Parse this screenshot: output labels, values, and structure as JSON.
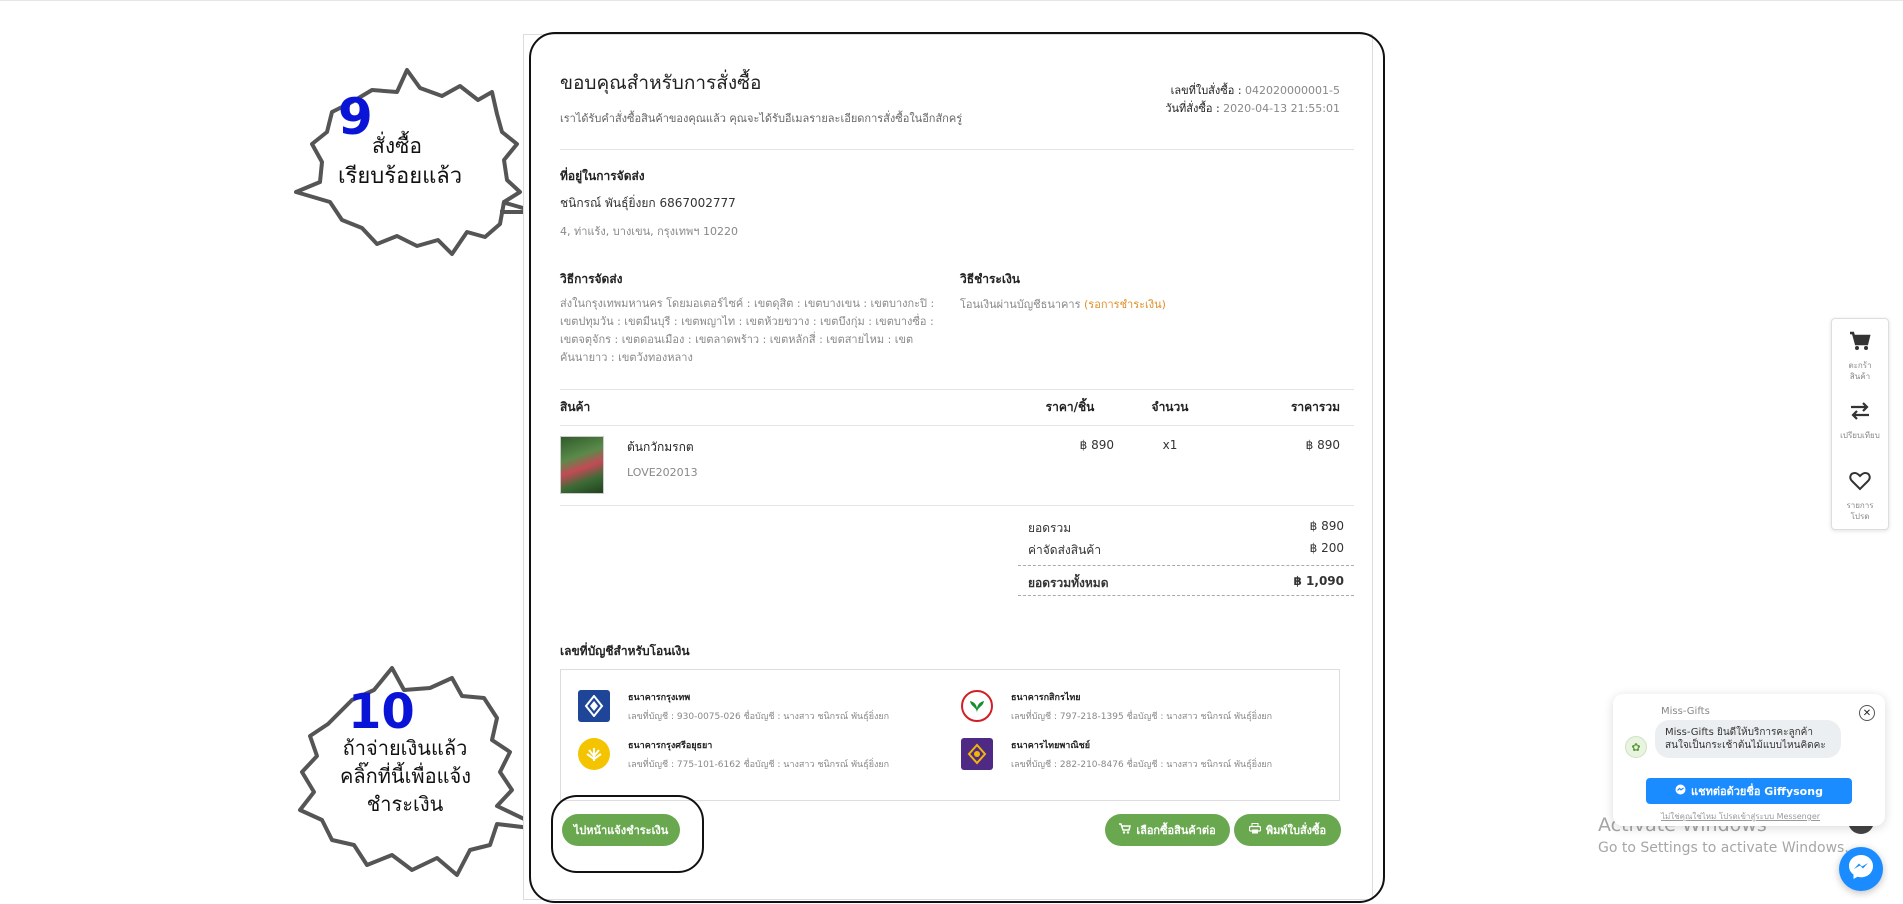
{
  "order": {
    "thanks_title": "ขอบคุณสำหรับการสั่งซื้อ",
    "thanks_subtitle": "เราได้รับคำสั่งซื้อสินค้าของคุณแล้ว คุณจะได้รับอีเมลรายละเอียดการสั่งซื้อในอีกสักครู่",
    "order_no_label": "เลขที่ใบสั่งซื้อ :",
    "order_no": "042020000001-5",
    "order_date_label": "วันที่สั่งซื้อ :",
    "order_date": "2020-04-13 21:55:01"
  },
  "address": {
    "title": "ที่อยู่ในการจัดส่ง",
    "name_phone": "ชนิกรณ์ พันธุ์ยิ่งยก   6867002777",
    "line": "4, ท่าแร้ง, บางเขน, กรุงเทพฯ 10220"
  },
  "shipping": {
    "title": "วิธีการจัดส่ง",
    "desc": "ส่งในกรุงเทพมหานคร โดยมอเตอร์ไซค์ : เขตดุสิต : เขตบางเขน : เขตบางกะปิ : เขตปทุมวัน : เขตมีนบุรี : เขตพญาไท : เขตห้วยขวาง : เขตบึงกุ่ม : เขตบางซื่อ : เขตจตุจักร : เขตดอนเมือง : เขตลาดพร้าว : เขตหลักสี่ : เขตสายไหม : เขตคันนายาว : เขตวังทองหลาง"
  },
  "payment": {
    "title": "วิธีชำระเงิน",
    "method": "โอนเงินผ่านบัญชีธนาคาร",
    "status": "(รอการชำระเงิน)"
  },
  "table": {
    "col_product": "สินค้า",
    "col_price": "ราคา/ชิ้น",
    "col_qty": "จำนวน",
    "col_total": "ราคารวม",
    "items": [
      {
        "name": "ต้นกวักมรกต",
        "sku": "LOVE202013",
        "price": "฿ 890",
        "qty": "x1",
        "total": "฿ 890"
      }
    ]
  },
  "totals": {
    "subtotal_label": "ยอดรวม",
    "subtotal": "฿ 890",
    "shipping_label": "ค่าจัดส่งสินค้า",
    "shipping": "฿ 200",
    "grand_label": "ยอดรวมทั้งหมด",
    "grand": "฿ 1,090"
  },
  "banks": {
    "title": "เลขที่บัญชีสำหรับโอนเงิน",
    "list": [
      {
        "name": "ธนาคารกรุงเทพ",
        "acct": "เลขที่บัญชี : 930-0075-026 ชื่อบัญชี : นางสาว ชนิกรณ์ พันธุ์ยิ่งยก",
        "color": "#1e4598",
        "icon": "bbl-logo-icon"
      },
      {
        "name": "ธนาคารกสิกรไทย",
        "acct": "เลขที่บัญชี : 797-218-1395 ชื่อบัญชี : นางสาว ชนิกรณ์ พันธุ์ยิ่งยก",
        "color": "#138f2d",
        "icon": "kbank-logo-icon"
      },
      {
        "name": "ธนาคารกรุงศรีอยุธยา",
        "acct": "เลขที่บัญชี : 775-101-6162 ชื่อบัญชี : นางสาว ชนิกรณ์ พันธุ์ยิ่งยก",
        "color": "#f5c400",
        "icon": "krungsri-logo-icon"
      },
      {
        "name": "ธนาคารไทยพาณิชย์",
        "acct": "เลขที่บัญชี : 282-210-8476 ชื่อบัญชี : นางสาว ชนิกรณ์ พันธุ์ยิ่งยก",
        "color": "#4e2a84",
        "icon": "scb-logo-icon"
      }
    ]
  },
  "buttons": {
    "pay_notify": "ไปหน้าแจ้งชำระเงิน",
    "continue": "เลือกซื้อสินค้าต่อ",
    "print": "พิมพ์ใบสั่งซื้อ"
  },
  "annotations": {
    "step9_num": "9",
    "step9_line1": "สั่งซื้อ",
    "step9_line2": "เรียบร้อยแล้ว",
    "step10_num": "10",
    "step10_line1": "ถ้าจ่ายเงินแล้ว",
    "step10_line2": "คลิ๊กที่นี้เพื่อแจ้ง",
    "step10_line3": "ชำระเงิน"
  },
  "sidebar": {
    "items": [
      {
        "label": "ตะกร้าสินค้า",
        "icon": "cart-icon"
      },
      {
        "label": "เปรียบเทียบ",
        "icon": "compare-icon"
      },
      {
        "label": "รายการโปรด",
        "icon": "heart-icon"
      }
    ]
  },
  "chat": {
    "page_name": "Miss-Gifts",
    "message": "Miss-Gifts ยินดีให้บริการคะลูกค้าสนใจเป็นกระเช้าต้นไม้แบบไหนคิดคะ",
    "button": "แชทต่อด้วยชื่อ Giffysong",
    "footer": "ไม่ใช่คุณใช่ไหม โปรดเข้าสู่ระบบ Messenger"
  },
  "watermark": {
    "line1": "Activate Windows",
    "line2": "Go to Settings to activate Windows."
  },
  "colors": {
    "button_green": "#6aa84f",
    "pending_orange": "#e0912a",
    "annotation_blue": "#0a14d6",
    "messenger_blue": "#1a8cff"
  }
}
